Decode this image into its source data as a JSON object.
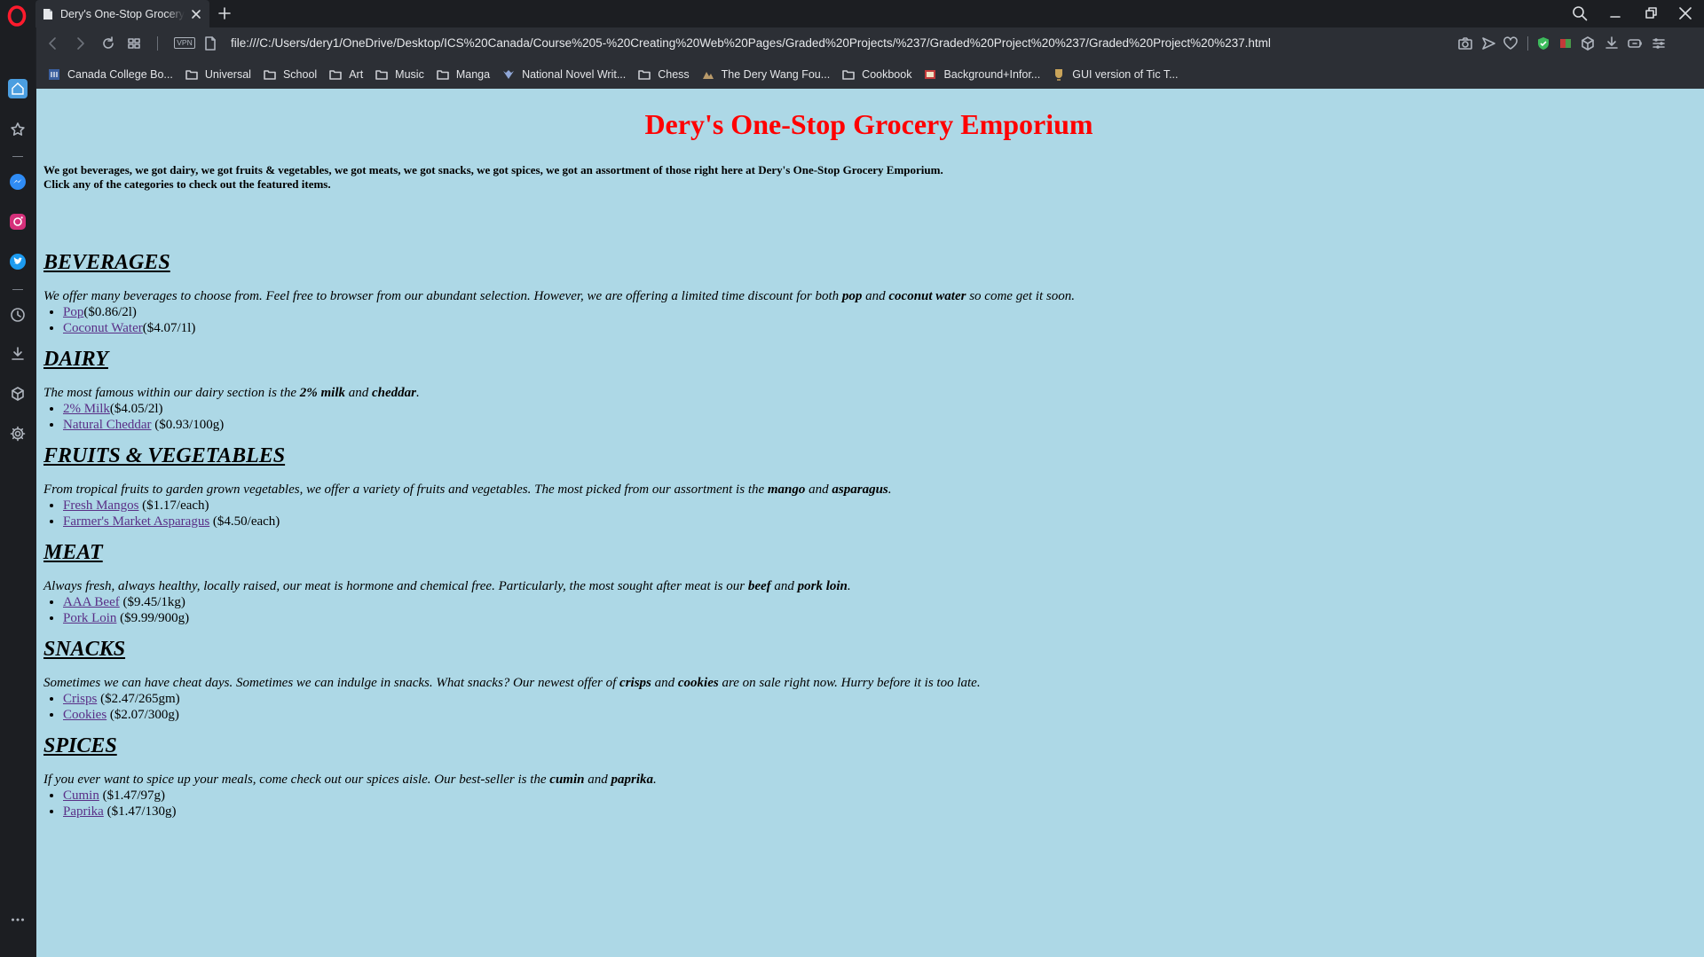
{
  "browser": {
    "tab": {
      "title": "Dery's One-Stop Grocery Emporium"
    },
    "vpn_label": "VPN",
    "address": "file:///C:/Users/dery1/OneDrive/Desktop/ICS%20Canada/Course%205-%20Creating%20Web%20Pages/Graded%20Projects/%237/Graded%20Project%20%237/Graded%20Project%20%237.html",
    "bookmarks": [
      {
        "label": "Canada College Bo...",
        "icon": "site-favicon"
      },
      {
        "label": "Universal",
        "icon": "folder-icon"
      },
      {
        "label": "School",
        "icon": "folder-icon"
      },
      {
        "label": "Art",
        "icon": "folder-icon"
      },
      {
        "label": "Music",
        "icon": "folder-icon"
      },
      {
        "label": "Manga",
        "icon": "folder-icon"
      },
      {
        "label": "National Novel Writ...",
        "icon": "site-favicon"
      },
      {
        "label": "Chess",
        "icon": "folder-icon"
      },
      {
        "label": "The Dery Wang Fou...",
        "icon": "site-favicon"
      },
      {
        "label": "Cookbook",
        "icon": "folder-icon"
      },
      {
        "label": "Background+Infor...",
        "icon": "site-favicon"
      },
      {
        "label": "GUI version of Tic T...",
        "icon": "site-favicon"
      }
    ]
  },
  "page": {
    "title": "Dery's One-Stop Grocery Emporium",
    "intro_line1": "We got beverages, we got dairy, we got fruits & vegetables, we got meats, we got snacks, we got spices, we got an assortment of those right here at Dery's One-Stop Grocery Emporium.",
    "intro_line2": "Click any of the categories to check out the featured items.",
    "sections": [
      {
        "heading": "BEVERAGES",
        "desc_before": "We offer many beverages to choose from. Feel free to browser from our abundant selection. However, we are offering a limited time discount for both ",
        "bold1": "pop",
        "mid": " and ",
        "bold2": "coconut water",
        "after": " so come get it soon.",
        "items": [
          {
            "name": "Pop",
            "price": "($0.86/2l)"
          },
          {
            "name": "Coconut Water",
            "price": "($4.07/1l)"
          }
        ]
      },
      {
        "heading": "DAIRY",
        "desc_before": "The most famous within our dairy section is the ",
        "bold1": "2% milk",
        "mid": " and ",
        "bold2": "cheddar",
        "after": ".",
        "items": [
          {
            "name": "2% Milk",
            "price": "($4.05/2l)"
          },
          {
            "name": "Natural Cheddar",
            "price": " ($0.93/100g)"
          }
        ]
      },
      {
        "heading": "FRUITS & VEGETABLES",
        "desc_before": "From tropical fruits to garden grown vegetables, we offer a variety of fruits and vegetables. The most picked from our assortment is the ",
        "bold1": "mango",
        "mid": " and ",
        "bold2": "asparagus",
        "after": ".",
        "items": [
          {
            "name": "Fresh Mangos",
            "price": " ($1.17/each)"
          },
          {
            "name": "Farmer's Market Asparagus",
            "price": " ($4.50/each)"
          }
        ]
      },
      {
        "heading": "MEAT",
        "desc_before": "Always fresh, always healthy, locally raised, our meat is hormone and chemical free. Particularly, the most sought after meat is our ",
        "bold1": "beef",
        "mid": " and ",
        "bold2": "pork loin",
        "after": ".",
        "items": [
          {
            "name": "AAA Beef",
            "price": " ($9.45/1kg)"
          },
          {
            "name": "Pork Loin",
            "price": " ($9.99/900g)"
          }
        ]
      },
      {
        "heading": "SNACKS",
        "desc_before": "Sometimes we can have cheat days. Sometimes we can indulge in snacks. What snacks? Our newest offer of ",
        "bold1": "crisps",
        "mid": " and ",
        "bold2": "cookies",
        "after": " are on sale right now. Hurry before it is too late.",
        "items": [
          {
            "name": "Crisps",
            "price": " ($2.47/265gm)"
          },
          {
            "name": "Cookies",
            "price": " ($2.07/300g)"
          }
        ]
      },
      {
        "heading": "SPICES",
        "desc_before": "If you ever want to spice up your meals, come check out our spices aisle. Our best-seller is the ",
        "bold1": "cumin",
        "mid": " and ",
        "bold2": "paprika",
        "after": ".",
        "items": [
          {
            "name": "Cumin",
            "price": " ($1.47/97g)"
          },
          {
            "name": "Paprika",
            "price": " ($1.47/130g)"
          }
        ]
      }
    ]
  },
  "colors": {
    "page_background": "#add8e6",
    "title": "#ff0000",
    "link": "#5a2f87",
    "browser_chrome": "#2c2f35",
    "opera_red": "#ff1b2d"
  }
}
